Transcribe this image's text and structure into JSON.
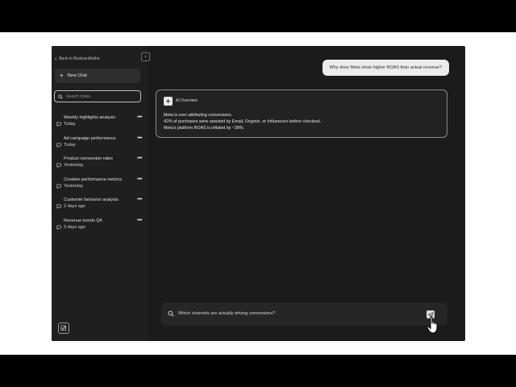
{
  "sidebar": {
    "back_label": "Back to BooleanMaths",
    "collapse_icon": "chevron-left-icon",
    "new_chat_label": "New Chat",
    "search_placeholder": "Search chats...",
    "chats": [
      {
        "title": "Weekly highlights analysis",
        "time": "Today"
      },
      {
        "title": "Ad campaign performance",
        "time": "Today"
      },
      {
        "title": "Product conversion rates",
        "time": "Yesterday"
      },
      {
        "title": "Creative performance metrics",
        "time": "Yesterday"
      },
      {
        "title": "Customer behavior analysis",
        "time": "2 days ago"
      },
      {
        "title": "Revenue trends Q4",
        "time": "3 days ago"
      }
    ],
    "more_label": "•••"
  },
  "conversation": {
    "user_message": "Why does Meta show higher ROAS than actual revenue?",
    "ai": {
      "badge_label": "AI Overview",
      "lines": [
        "Meta is over-attributing conversions.",
        "42% of purchases were assisted by Email, Organic, or Influencers before checkout.",
        "Meta's platform ROAS is inflated by ~38%."
      ]
    }
  },
  "composer": {
    "value": "Which channels are actually driving conversions?"
  },
  "colors": {
    "app_bg": "#1b1b1b",
    "sidebar_bg": "#1f1f1f",
    "user_bubble": "#ececec",
    "card_border": "#8c8c8c"
  }
}
